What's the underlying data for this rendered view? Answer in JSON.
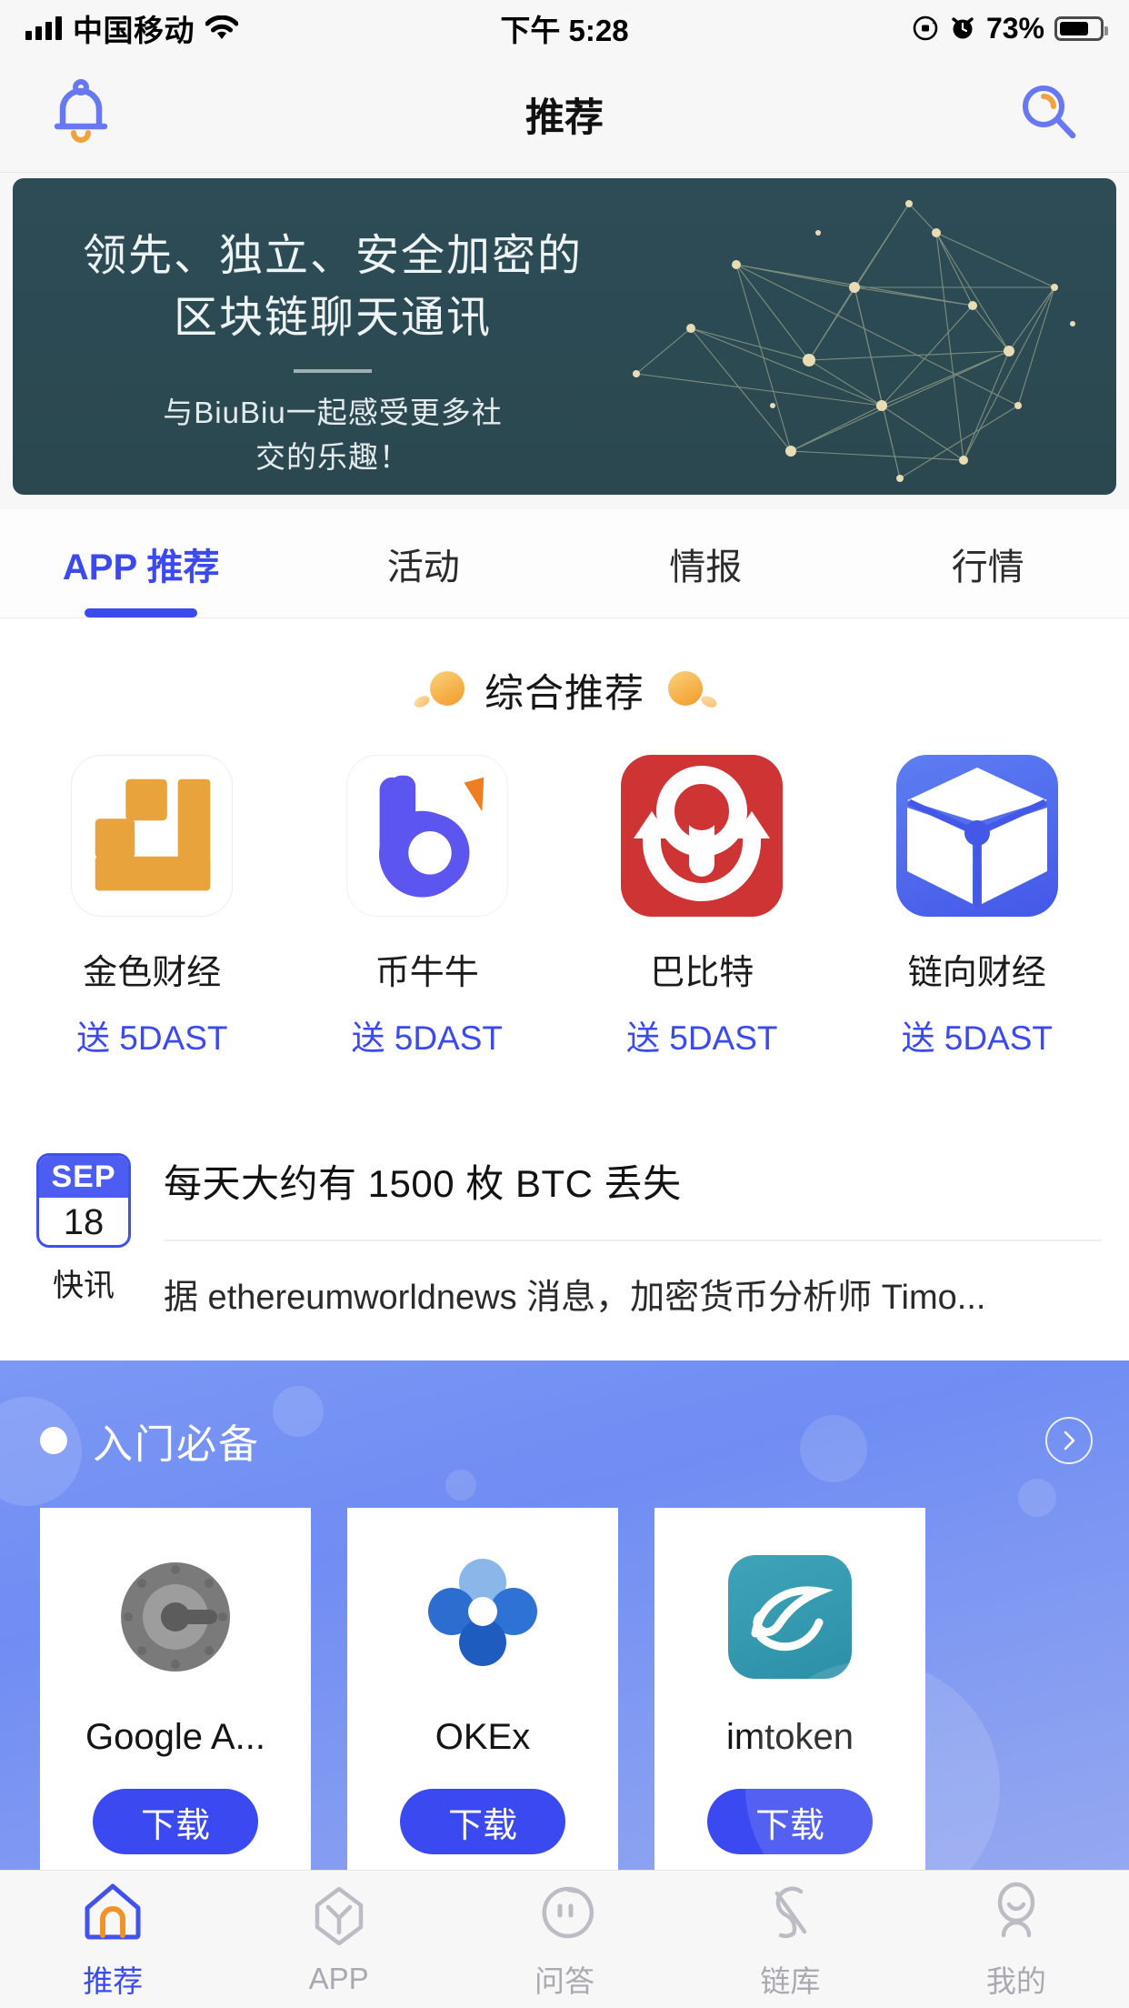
{
  "status_bar": {
    "carrier": "中国移动",
    "wifi_icon": "wifi-icon",
    "signal_icon": "signal-bars-icon",
    "time": "下午 5:28",
    "rotation_lock_icon": "rotation-lock-icon",
    "alarm_icon": "alarm-clock-icon",
    "battery_percent": "73%",
    "battery_icon": "battery-icon"
  },
  "navbar": {
    "title": "推荐",
    "bell_icon": "bell-icon",
    "search_icon": "search-icon"
  },
  "banner": {
    "headline_line1": "领先、独立、安全加密的",
    "headline_line2": "区块链聊天通讯",
    "subline1": "与BiuBiu一起感受更多社",
    "subline2": "交的乐趣！",
    "bg_color": "#2d4c56",
    "accent_color": "#e9dfbe",
    "art_icon": "network-graph-illustration"
  },
  "tabs": [
    {
      "label": "APP 推荐",
      "active": true
    },
    {
      "label": "活动",
      "active": false
    },
    {
      "label": "情报",
      "active": false
    },
    {
      "label": "行情",
      "active": false
    }
  ],
  "recommend_section": {
    "title": "综合推荐",
    "decoration_icon": "orange-ball-decoration",
    "apps": [
      {
        "name": "金色财经",
        "gift": "送 5DAST",
        "icon": "jinse-finance-icon",
        "color": "#e8a33d"
      },
      {
        "name": "币牛牛",
        "gift": "送 5DAST",
        "icon": "biuniuniu-icon",
        "color": "#5d55ef"
      },
      {
        "name": "巴比特",
        "gift": "送 5DAST",
        "icon": "babite-icon",
        "color": "#cf3434"
      },
      {
        "name": "链向财经",
        "gift": "送 5DAST",
        "icon": "lianxiang-finance-icon",
        "color": "#4458e8"
      }
    ]
  },
  "news_card": {
    "month": "SEP",
    "day": "18",
    "tag": "快讯",
    "title": "每天大约有 1500 枚 BTC 丢失",
    "description": "据 ethereumworldnews 消息，加密货币分析师 Timo..."
  },
  "promo_section": {
    "title": "入门必备",
    "bullet_icon": "dot-bullet-icon",
    "next_icon": "chevron-right-icon",
    "accent_color": "#3b49f0",
    "cards": [
      {
        "name": "Google A...",
        "button": "下载",
        "icon": "google-authenticator-icon"
      },
      {
        "name": "OKEx",
        "button": "下载",
        "icon": "okex-icon"
      },
      {
        "name": "imtoken",
        "button": "下载",
        "icon": "imtoken-icon"
      }
    ]
  },
  "tabbar": [
    {
      "label": "推荐",
      "icon": "home-icon",
      "active": true
    },
    {
      "label": "APP",
      "icon": "hexagon-app-icon",
      "active": false
    },
    {
      "label": "问答",
      "icon": "qa-bubble-icon",
      "active": false
    },
    {
      "label": "链库",
      "icon": "chain-link-icon",
      "active": false
    },
    {
      "label": "我的",
      "icon": "user-profile-icon",
      "active": false
    }
  ]
}
